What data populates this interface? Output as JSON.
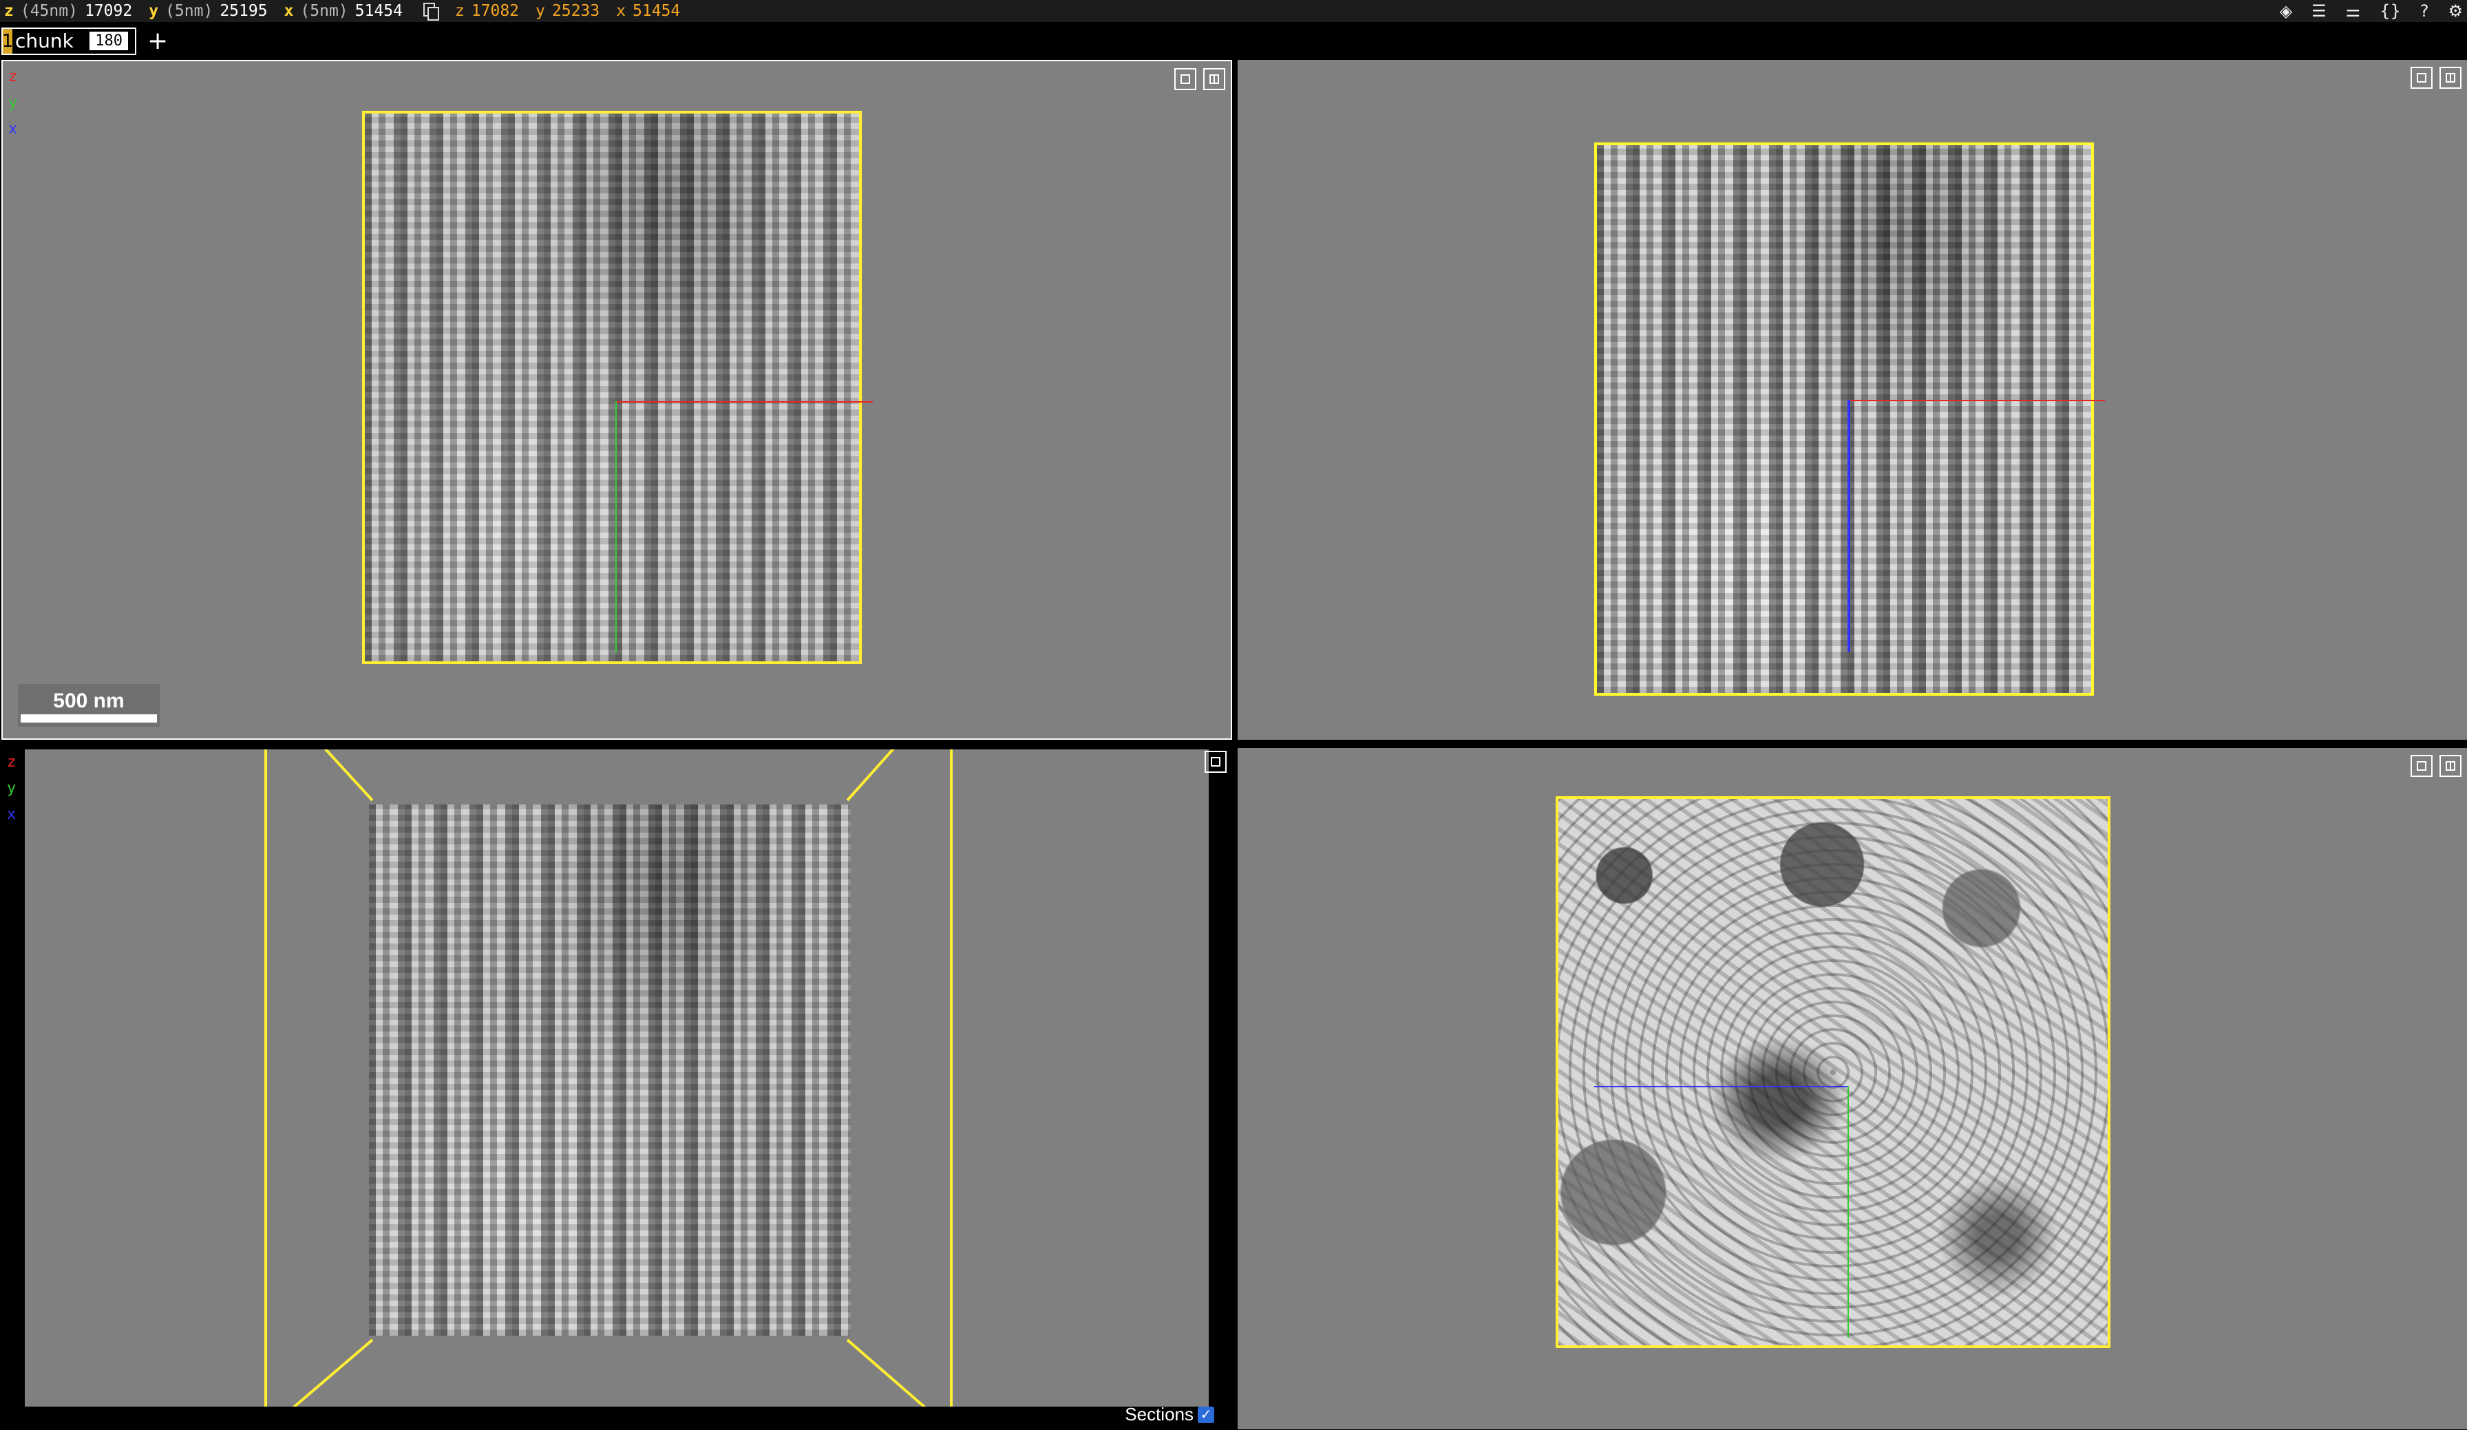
{
  "position": {
    "z": {
      "axis": "z",
      "resolution": "(45nm)",
      "value": "17092"
    },
    "y": {
      "axis": "y",
      "resolution": "(5nm)",
      "value": "25195"
    },
    "x": {
      "axis": "x",
      "resolution": "(5nm)",
      "value": "51454"
    }
  },
  "mouse_position": {
    "z": {
      "axis": "z",
      "value": "17082"
    },
    "y": {
      "axis": "y",
      "value": "25233"
    },
    "x": {
      "axis": "x",
      "value": "51454"
    }
  },
  "toolbar_icons": [
    "layers-icon",
    "list-icon",
    "sliders-icon",
    "braces-icon",
    "help-icon",
    "settings-icon"
  ],
  "toolbar_glyphs": {
    "layers": "◈",
    "list": "☰",
    "sliders": "⚌",
    "braces": "{}",
    "help": "?",
    "settings": "⚙"
  },
  "layer_tab": {
    "number": "1",
    "name": "chunk",
    "value": "180"
  },
  "add_layer_label": "+",
  "axis_labels": {
    "z": "z",
    "y": "y",
    "x": "x"
  },
  "scale_bar": {
    "label": "500 nm"
  },
  "sections": {
    "label": "Sections",
    "checked": true,
    "check_glyph": "✓"
  },
  "colors": {
    "slice_border": "#ffee33",
    "x_axis": "#e22",
    "y_axis": "#3c3",
    "z_axis": "#33f",
    "panel_bg": "#808080"
  }
}
